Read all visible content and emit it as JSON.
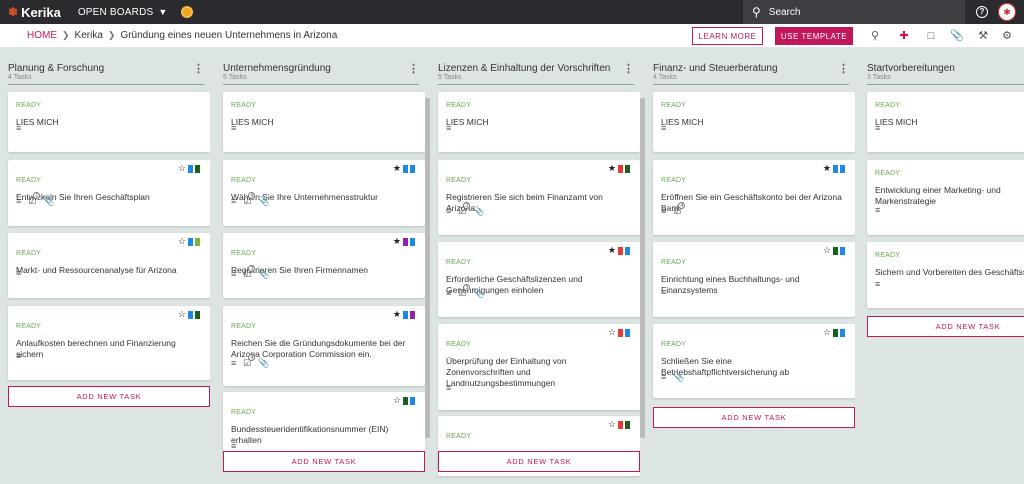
{
  "topbar": {
    "logo": "Kerika",
    "open_boards": "OPEN BOARDS",
    "search_placeholder": "Search",
    "help": "?",
    "avatar": "✱"
  },
  "subbar": {
    "home": "HOME",
    "crumb1": "Kerika",
    "crumb2": "Gründung eines neuen Unternehmens in Arizona",
    "learn_more": "LEARN MORE",
    "use_template": "USE TEMPLATE"
  },
  "colors": {
    "accent": "#c2185b",
    "status": "#6aa84f",
    "star": "#d32f2f",
    "blue": "#1e88e5",
    "green": "#1b5e20",
    "darkgreen": "#2e7d32",
    "purple": "#8e24aa",
    "red": "#e53935",
    "lightgreen": "#7cb342"
  },
  "add_task_label": "ADD NEW TASK",
  "columns": [
    {
      "title": "Planung & Forschung",
      "count": "4 Tasks",
      "cards": [
        {
          "status": "READY",
          "title": "LIES MICH",
          "star": "",
          "flags": [],
          "meta": [
            "desc"
          ]
        },
        {
          "status": "READY",
          "title": "Entwickeln Sie Ihren Geschäftsplan",
          "star": "☆",
          "flags": [
            "blue",
            "green"
          ],
          "meta": [
            "desc",
            "chk",
            "clip"
          ],
          "chk": "1"
        },
        {
          "status": "READY",
          "title": "Markt- und Ressourcenanalyse für Arizona",
          "star": "☆",
          "flags": [
            "blue",
            "lightgreen"
          ],
          "meta": [
            "desc"
          ]
        },
        {
          "status": "READY",
          "title": "Anlaufkosten berechnen und Finanzierung sichern",
          "star": "☆",
          "flags": [
            "blue",
            "green"
          ],
          "meta": [
            "desc"
          ]
        }
      ]
    },
    {
      "title": "Unternehmensgründung",
      "count": "5 Tasks",
      "cards": [
        {
          "status": "READY",
          "title": "LIES MICH",
          "star": "",
          "flags": [],
          "meta": [
            "desc"
          ]
        },
        {
          "status": "READY",
          "title": "Wählen Sie Ihre Unternehmensstruktur",
          "star": "★",
          "flags": [
            "blue",
            "blue"
          ],
          "meta": [
            "desc",
            "chk",
            "clip"
          ],
          "chk": "4"
        },
        {
          "status": "READY",
          "title": "Registrieren Sie Ihren Firmennamen",
          "star": "★",
          "flags": [
            "purple",
            "blue"
          ],
          "meta": [
            "desc",
            "chk",
            "clip"
          ],
          "chk": "3"
        },
        {
          "status": "READY",
          "title": "Reichen Sie die Gründungsdokumente bei der Arizona Corporation Commission ein.",
          "star": "★",
          "flags": [
            "blue",
            "purple"
          ],
          "meta": [
            "desc",
            "chk",
            "clip"
          ],
          "chk": "4"
        },
        {
          "status": "READY",
          "title": "Bundessteueridentifikationsnummer (EIN) erhalten",
          "star": "☆",
          "flags": [
            "green",
            "blue"
          ],
          "meta": [
            "desc"
          ]
        }
      ]
    },
    {
      "title": "Lizenzen & Einhaltung der Vorschriften",
      "count": "5 Tasks",
      "cards": [
        {
          "status": "READY",
          "title": "LIES MICH",
          "star": "",
          "flags": [],
          "meta": [
            "desc"
          ]
        },
        {
          "status": "READY",
          "title": "Registrieren Sie sich beim Finanzamt von Arizona.",
          "star": "★",
          "flags": [
            "red",
            "green"
          ],
          "meta": [
            "desc",
            "chk",
            "clip"
          ],
          "chk": "3"
        },
        {
          "status": "READY",
          "title": "Erforderliche Geschäftslizenzen und Genehmigungen einholen",
          "star": "★",
          "flags": [
            "red",
            "blue"
          ],
          "meta": [
            "desc",
            "chk",
            "clip"
          ],
          "chk": "3"
        },
        {
          "status": "READY",
          "title": "Überprüfung der Einhaltung von Zonenvorschriften und Landnutzungsbestimmungen",
          "star": "☆",
          "flags": [
            "red",
            "blue"
          ],
          "meta": [
            "desc"
          ]
        },
        {
          "status": "READY",
          "title": "",
          "star": "☆",
          "flags": [
            "red",
            "green"
          ],
          "meta": []
        }
      ]
    },
    {
      "title": "Finanz- und Steuerberatung",
      "count": "4 Tasks",
      "cards": [
        {
          "status": "READY",
          "title": "LIES MICH",
          "star": "",
          "flags": [],
          "meta": [
            "desc"
          ]
        },
        {
          "status": "READY",
          "title": "Eröffnen Sie ein Geschäftskonto bei der Arizona Bank",
          "star": "★",
          "flags": [
            "blue",
            "blue"
          ],
          "meta": [
            "desc",
            "chk"
          ],
          "chk": "4"
        },
        {
          "status": "READY",
          "title": "Einrichtung eines Buchhaltungs- und Finanzsystems",
          "star": "☆",
          "flags": [
            "green",
            "blue"
          ],
          "meta": [
            "desc"
          ]
        },
        {
          "status": "READY",
          "title": "Schließen Sie eine Betriebshaftpflichtversicherung ab",
          "star": "☆",
          "flags": [
            "green",
            "blue"
          ],
          "meta": [
            "desc",
            "clip"
          ]
        }
      ]
    },
    {
      "title": "Startvorbereitungen",
      "count": "3 Tasks",
      "cards": [
        {
          "status": "READY",
          "title": "LIES MICH",
          "star": "",
          "flags": [],
          "meta": [
            "desc"
          ]
        },
        {
          "status": "READY",
          "title": "Entwicklung einer Marketing- und Markenstrategie",
          "star": "",
          "flags": [],
          "meta": [
            "desc"
          ]
        },
        {
          "status": "READY",
          "title": "Sichern und Vorbereiten des Geschäftssitzes",
          "star": "",
          "flags": [],
          "meta": [
            "desc"
          ]
        }
      ]
    }
  ]
}
